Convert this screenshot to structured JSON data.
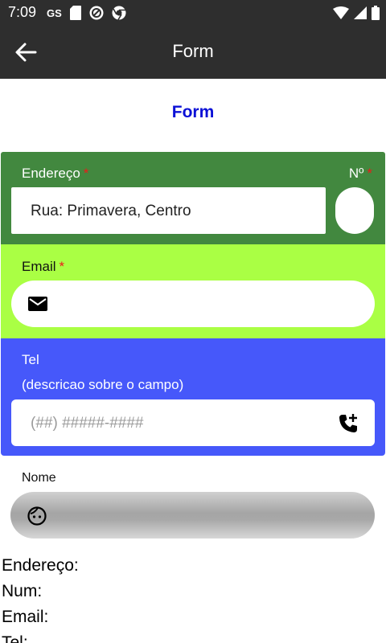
{
  "status_bar": {
    "time": "7:09",
    "carrier_badge": "GS",
    "icons_left": [
      "sd-card-icon",
      "sync-circle-icon",
      "chrome-icon"
    ],
    "icons_right": [
      "wifi-icon",
      "signal-icon",
      "battery-icon"
    ]
  },
  "app_bar": {
    "title": "Form",
    "back_icon": "arrow-back-icon"
  },
  "page": {
    "title": "Form"
  },
  "colors": {
    "app_bar": "#2e2e2e",
    "title_blue": "#0b10d6",
    "address_section": "#42883f",
    "email_section": "#aaff44",
    "tel_section": "#4658fa",
    "required_star": "#ee1a1a"
  },
  "address_section": {
    "address_label": "Endereço",
    "address_required": "*",
    "address_value": "Rua: Primavera, Centro",
    "number_label": "Nº",
    "number_required": "*",
    "number_value": ""
  },
  "email_section": {
    "label": "Email",
    "required": "*",
    "icon": "email-icon",
    "value": ""
  },
  "tel_section": {
    "label": "Tel",
    "description": "(descricao sobre o campo)",
    "placeholder": "(##) #####-####",
    "icon": "add-call-icon"
  },
  "nome_section": {
    "label": "Nome",
    "icon": "face-icon",
    "value": ""
  },
  "summary": {
    "endereco": "Endereço:",
    "num": "Num:",
    "email": "Email:",
    "tel": "Tel:"
  }
}
